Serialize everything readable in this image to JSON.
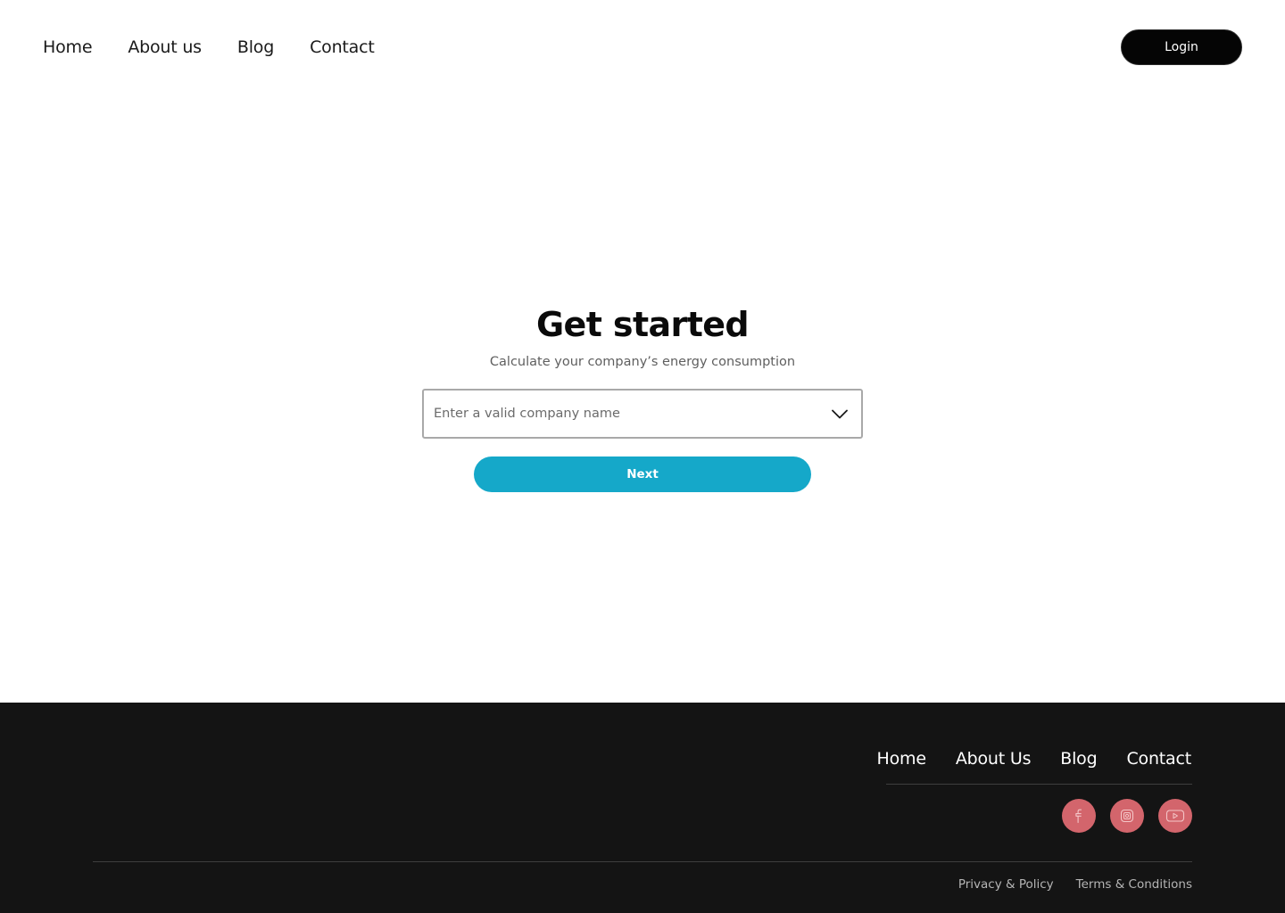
{
  "header": {
    "nav": [
      {
        "label": "Home"
      },
      {
        "label": "About us"
      },
      {
        "label": "Blog"
      },
      {
        "label": "Contact"
      }
    ],
    "login_label": "Login"
  },
  "main": {
    "title": "Get started",
    "subtitle": "Calculate your company’s energy consumption",
    "company_select": {
      "placeholder": "Enter a valid company name",
      "icon": "chevron-down-icon"
    },
    "next_label": "Next"
  },
  "footer": {
    "nav": [
      {
        "label": "Home"
      },
      {
        "label": "About Us"
      },
      {
        "label": "Blog"
      },
      {
        "label": "Contact"
      }
    ],
    "socials": [
      {
        "icon": "facebook-icon"
      },
      {
        "icon": "instagram-icon"
      },
      {
        "icon": "youtube-icon"
      }
    ],
    "legal": [
      {
        "label": "Privacy & Policy"
      },
      {
        "label": "Terms & Conditions"
      }
    ]
  },
  "colors": {
    "accent": "#15a8c9",
    "social": "#d3656c",
    "footer_bg": "#141414",
    "login_bg": "#050505"
  }
}
